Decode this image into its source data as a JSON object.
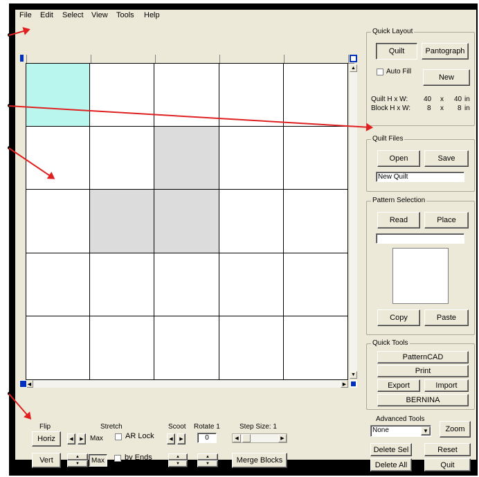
{
  "menu": [
    "File",
    "Edit",
    "Select",
    "View",
    "Tools",
    "Help"
  ],
  "quick_layout": {
    "title": "Quick Layout",
    "quilt": "Quilt",
    "pantograph": "Pantograph",
    "auto_fill": "Auto Fill",
    "new": "New",
    "quilt_hw_label": "Quilt H x W:",
    "quilt_h": "40",
    "quilt_x": "x",
    "quilt_w": "40",
    "quilt_unit": "in",
    "block_hw_label": "Block H x W:",
    "block_h": "8",
    "block_x": "x",
    "block_w": "8",
    "block_unit": "in"
  },
  "quilt_files": {
    "title": "Quilt Files",
    "open": "Open",
    "save": "Save",
    "name_value": "New Quilt"
  },
  "pattern_selection": {
    "title": "Pattern Selection",
    "read": "Read",
    "place": "Place",
    "copy": "Copy",
    "paste": "Paste"
  },
  "quick_tools": {
    "title": "Quick Tools",
    "patterncad": "PatternCAD",
    "print": "Print",
    "export": "Export",
    "import": "Import",
    "bernina": "BERNINA"
  },
  "advanced_tools": {
    "title": "Advanced Tools",
    "selected": "None",
    "zoom": "Zoom",
    "delete_sel": "Delete Sel",
    "reset": "Reset",
    "delete_all": "Delete All",
    "quit": "Quit"
  },
  "bottom": {
    "flip": "Flip",
    "horiz": "Horiz",
    "vert": "Vert",
    "stretch": "Stretch",
    "max1": "Max",
    "max2": "Max",
    "ar_lock": "AR Lock",
    "by_ends": "by Ends",
    "scoot": "Scoot",
    "rotate": "Rotate 1",
    "rotate_value": "0",
    "step_size": "Step Size: 1",
    "merge_blocks": "Merge Blocks"
  },
  "grid": {
    "rows": 5,
    "cols": 5,
    "cells": [
      [
        "cyan",
        "white",
        "white",
        "white",
        "white"
      ],
      [
        "white",
        "white",
        "grey",
        "white",
        "white"
      ],
      [
        "white",
        "grey",
        "grey",
        "white",
        "white"
      ],
      [
        "white",
        "white",
        "white",
        "white",
        "white"
      ],
      [
        "white",
        "white",
        "white",
        "white",
        "white"
      ]
    ]
  },
  "colors": {
    "cyan": "#b8f6ee",
    "grey": "#dcdcdc",
    "white": "#ffffff",
    "arrow": "#e02020"
  }
}
